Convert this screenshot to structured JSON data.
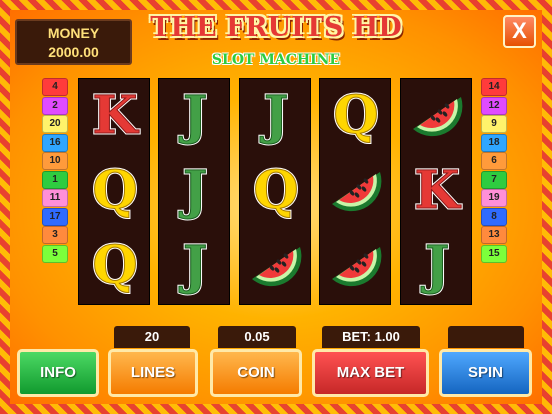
{
  "header": {
    "title": "THE FRUITS HD",
    "subtitle": "SLOT MACHINE",
    "close_label": "X"
  },
  "money": {
    "label": "MONEY",
    "value": "2000.00"
  },
  "lines_left": [
    {
      "n": "4",
      "color": "#ff3b3b"
    },
    {
      "n": "2",
      "color": "#e04bff"
    },
    {
      "n": "20",
      "color": "#fff36b"
    },
    {
      "n": "16",
      "color": "#2fa6ff"
    },
    {
      "n": "10",
      "color": "#ff9b3b"
    },
    {
      "n": "1",
      "color": "#2ecc40"
    },
    {
      "n": "11",
      "color": "#ff8fd8"
    },
    {
      "n": "17",
      "color": "#2f6bff"
    },
    {
      "n": "3",
      "color": "#ff8a3d"
    },
    {
      "n": "5",
      "color": "#7cff3b"
    }
  ],
  "lines_right": [
    {
      "n": "14",
      "color": "#ff3b3b"
    },
    {
      "n": "12",
      "color": "#e04bff"
    },
    {
      "n": "9",
      "color": "#fff36b"
    },
    {
      "n": "18",
      "color": "#2fa6ff"
    },
    {
      "n": "6",
      "color": "#ff9b3b"
    },
    {
      "n": "7",
      "color": "#2ecc40"
    },
    {
      "n": "19",
      "color": "#ff8fd8"
    },
    {
      "n": "8",
      "color": "#2f6bff"
    },
    {
      "n": "13",
      "color": "#ff8a3d"
    },
    {
      "n": "15",
      "color": "#7cff3b"
    }
  ],
  "reels": [
    [
      "K",
      "Q",
      "Q"
    ],
    [
      "J",
      "J",
      "J"
    ],
    [
      "J",
      "Q",
      "watermelon"
    ],
    [
      "Q",
      "watermelon",
      "watermelon"
    ],
    [
      "watermelon",
      "K",
      "J"
    ]
  ],
  "controls": {
    "lines_value": "20",
    "coin_value": "0.05",
    "bet_value": "BET: 1.00",
    "spin_value": "",
    "info_label": "INFO",
    "lines_label": "LINES",
    "coin_label": "COIN",
    "maxbet_label": "MAX BET",
    "spin_label": "SPIN"
  }
}
